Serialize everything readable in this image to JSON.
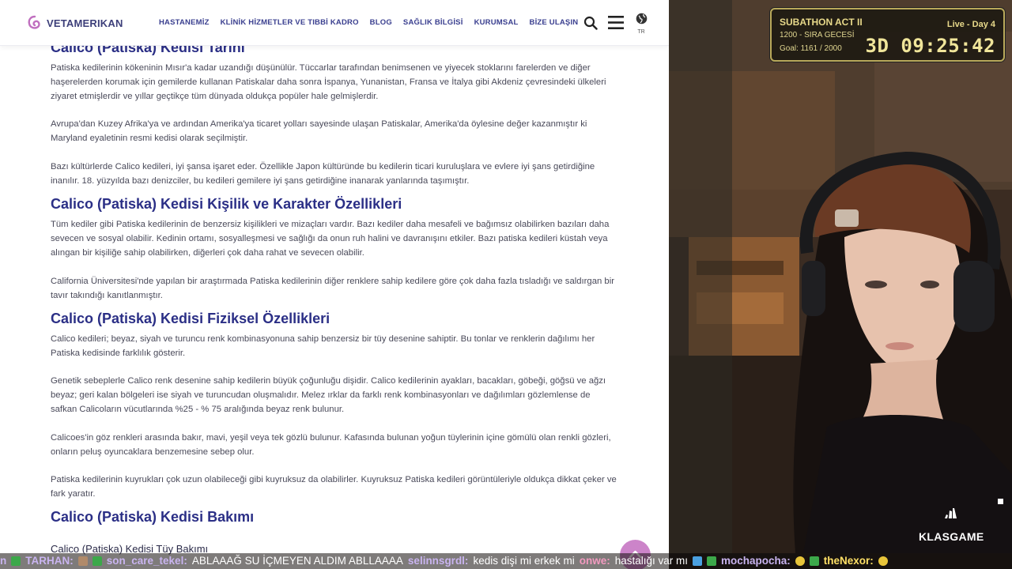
{
  "site": {
    "logo_text": "VETAMERIKAN",
    "nav": [
      "HASTANEMİZ",
      "KLİNİK HİZMETLER VE TIBBİ KADRO",
      "BLOG",
      "SAĞLIK BİLGİSİ",
      "KURUMSAL",
      "BİZE ULAŞIN"
    ],
    "lang_label": "TR",
    "icons": {
      "search": "search-icon",
      "menu": "hamburger-menu-icon",
      "lang": "globe-icon",
      "scroll_top": "chevron-up-icon"
    }
  },
  "article": {
    "h2_history": "Calico (Patiska) Kedisi Tarihi",
    "p_history_1": "Patiska kedilerinin kökeninin Mısır'a kadar uzandığı düşünülür. Tüccarlar tarafından benimsenen ve yiyecek stoklarını farelerden ve diğer haşerelerden korumak için gemilerde kullanan Patiskalar daha sonra İspanya, Yunanistan, Fransa ve İtalya gibi Akdeniz çevresindeki ülkeleri ziyaret etmişlerdir ve yıllar geçtikçe tüm dünyada oldukça popüler hale gelmişlerdir.",
    "p_history_2": "Avrupa'dan Kuzey Afrika'ya ve ardından Amerika'ya ticaret yolları sayesinde ulaşan Patiskalar, Amerika'da öylesine değer kazanmıştır ki Maryland eyaletinin resmi kedisi olarak seçilmiştir.",
    "p_history_3": "Bazı kültürlerde Calico kedileri, iyi şansa işaret eder. Özellikle Japon kültüründe bu kedilerin ticari kuruluşlara ve evlere iyi şans getirdiğine inanılır. 18. yüzyılda bazı denizciler, bu kedileri gemilere iyi şans getirdiğine inanarak yanlarında taşımıştır.",
    "h2_personality": "Calico (Patiska) Kedisi Kişilik ve Karakter Özellikleri",
    "p_personality_1": "Tüm kediler gibi Patiska kedilerinin de benzersiz kişilikleri ve mizaçları vardır. Bazı kediler daha mesafeli ve bağımsız olabilirken bazıları daha sevecen ve sosyal olabilir. Kedinin ortamı, sosyalleşmesi ve sağlığı da onun ruh halini ve davranışını etkiler. Bazı patiska kedileri küstah veya alıngan bir kişiliğe sahip olabilirken, diğerleri çok daha rahat ve sevecen olabilir.",
    "p_personality_2": "California Üniversitesi'nde yapılan bir araştırmada Patiska kedilerinin diğer renklere sahip kedilere göre çok daha fazla tısladığı ve saldırgan bir tavır takındığı kanıtlanmıştır.",
    "h2_physical": "Calico (Patiska) Kedisi Fiziksel Özellikleri",
    "p_physical_1": "Calico kedileri; beyaz, siyah ve turuncu renk kombinasyonuna sahip benzersiz bir tüy desenine sahiptir. Bu tonlar ve renklerin dağılımı her Patiska kedisinde farklılık gösterir.",
    "p_physical_2": "Genetik sebeplerle Calico renk desenine sahip kedilerin büyük çoğunluğu dişidir. Calico kedilerinin ayakları, bacakları, göbeği, göğsü ve ağzı beyaz; geri kalan bölgeleri ise siyah ve turuncudan oluşmalıdır. Melez ırklar da farklı renk kombinasyonları ve dağılımları gözlemlense de safkan Calicoların vücutlarında %25 - % 75 aralığında beyaz renk bulunur.",
    "p_physical_3": "Calicoes'in göz renkleri arasında bakır, mavi, yeşil veya tek gözlü bulunur. Kafasında bulunan yoğun tüylerinin içine gömülü olan renkli gözleri, onların peluş oyuncaklara benzemesine sebep olur.",
    "p_physical_4": "Patiska kedilerinin kuyrukları çok uzun olabileceği gibi kuyruksuz da olabilirler. Kuyruksuz Patiska kedileri görüntüleriyle oldukça dikkat çeker ve fark yaratır.",
    "h2_care": "Calico (Patiska) Kedisi Bakımı",
    "h3_fur": "Calico (Patiska) Kedisi Tüy Bakımı"
  },
  "overlay": {
    "timer": {
      "title": "SUBATHON ACT II",
      "subtitle": "1200 - SIRA GECESİ",
      "goal": "Goal: 1161 / 2000",
      "live": "Live - Day 4",
      "clock": "3D 09:25:42"
    },
    "sponsor": "KLASGAME",
    "chat": [
      {
        "name": "n",
        "msg": ""
      },
      {
        "name": "TARHAN:",
        "msg": ""
      },
      {
        "name": "son_care_tekel:",
        "msg": "ABLAAAĞ SU İÇMEYEN ALDIM ABLLAAAA"
      },
      {
        "name": "selinnsgrdl:",
        "msg": "kedis dişi mi erkek mi"
      },
      {
        "name": "onwe:",
        "msg": "hastalığı var mı"
      },
      {
        "name": "mochapocha:",
        "msg": ""
      },
      {
        "name": "theNexor:",
        "msg": ""
      }
    ],
    "colors": {
      "accent_name": "#c9b4f0",
      "timer_border": "#b9a95a",
      "heading": "#2b2f86"
    }
  }
}
